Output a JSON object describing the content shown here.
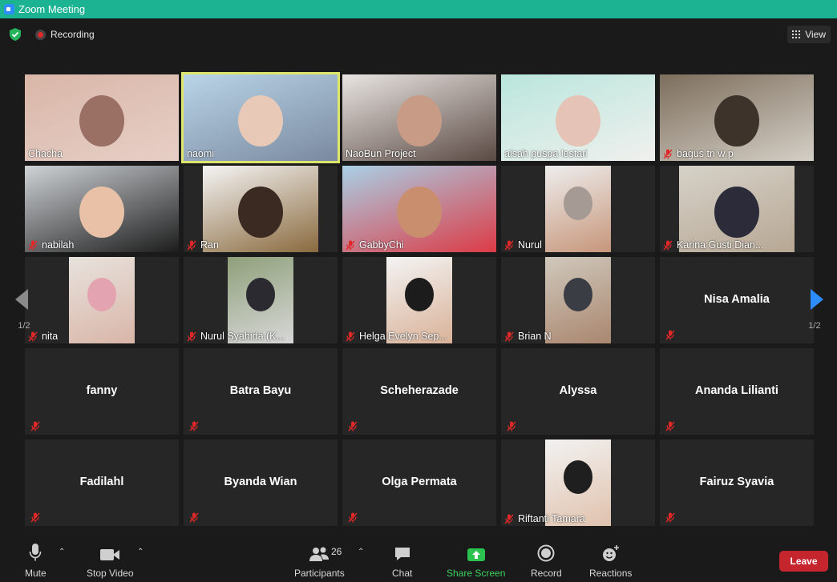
{
  "window": {
    "title": "Zoom Meeting"
  },
  "topbar": {
    "recording_label": "Recording",
    "view_label": "View"
  },
  "pager": {
    "left_label": "1/2",
    "right_label": "1/2"
  },
  "participants": [
    {
      "name": "Chacha",
      "video": true,
      "muted": false
    },
    {
      "name": "naomi",
      "video": true,
      "muted": false,
      "active_speaker": true
    },
    {
      "name": "NaoBun Project",
      "video": true,
      "muted": false
    },
    {
      "name": "aisah puspa lestari",
      "video": true,
      "muted": false
    },
    {
      "name": "bagus tri w p",
      "video": true,
      "muted": true
    },
    {
      "name": "nabilah",
      "video": true,
      "muted": true
    },
    {
      "name": "Ran",
      "video": true,
      "muted": true
    },
    {
      "name": "GabbyChi",
      "video": true,
      "muted": true
    },
    {
      "name": "Nurul",
      "video": true,
      "muted": true
    },
    {
      "name": "Karina Gusti Dian...",
      "video": true,
      "muted": true
    },
    {
      "name": "nita",
      "video": true,
      "muted": true
    },
    {
      "name": "Nurul Syahida (K...",
      "video": true,
      "muted": true
    },
    {
      "name": "Helga Evelyn Sep...",
      "video": true,
      "muted": true
    },
    {
      "name": "Brian N",
      "video": true,
      "muted": true
    },
    {
      "name": "Nisa Amalia",
      "video": false,
      "muted": true
    },
    {
      "name": "fanny",
      "video": false,
      "muted": true
    },
    {
      "name": "Batra Bayu",
      "video": false,
      "muted": true
    },
    {
      "name": "Scheherazade",
      "video": false,
      "muted": true
    },
    {
      "name": "Alyssa",
      "video": false,
      "muted": true
    },
    {
      "name": "Ananda Lilianti",
      "video": false,
      "muted": true
    },
    {
      "name": "Fadilahl",
      "video": false,
      "muted": true
    },
    {
      "name": "Byanda Wian",
      "video": false,
      "muted": true
    },
    {
      "name": "Olga Permata",
      "video": false,
      "muted": true
    },
    {
      "name": "Riftanti Tamara",
      "video": true,
      "muted": true
    },
    {
      "name": "Fairuz Syavia",
      "video": false,
      "muted": true
    }
  ],
  "toolbar": {
    "mute_label": "Mute",
    "stop_video_label": "Stop Video",
    "participants_label": "Participants",
    "participants_count": "26",
    "chat_label": "Chat",
    "share_label": "Share Screen",
    "record_label": "Record",
    "reactions_label": "Reactions",
    "leave_label": "Leave"
  },
  "colors": {
    "title_bar": "#1cb393",
    "active_speaker": "#dde56c",
    "share": "#3ed25f",
    "leave": "#c5262e",
    "mute_icon": "#e02828"
  },
  "icons": [
    "shield-check-icon",
    "record-icon",
    "grid-view-icon",
    "microphone-icon",
    "video-camera-icon",
    "participants-icon",
    "chat-icon",
    "share-screen-icon",
    "record-button-icon",
    "reactions-icon",
    "muted-mic-icon",
    "prev-page-icon",
    "next-page-icon"
  ]
}
